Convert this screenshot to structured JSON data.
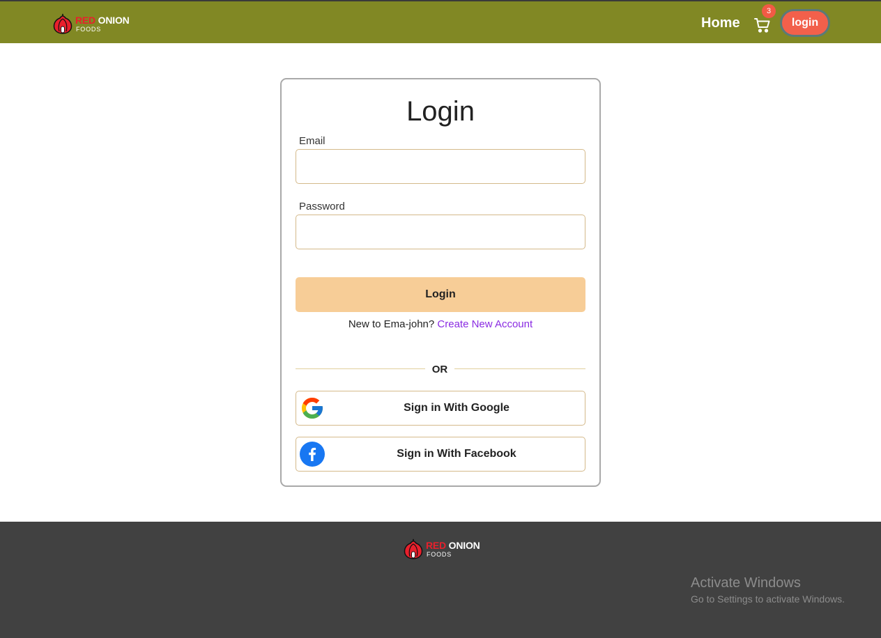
{
  "brand": {
    "name_red": "RED",
    "name_white": "ONION",
    "tagline": "FOODS"
  },
  "nav": {
    "home_label": "Home",
    "cart_count": "3",
    "login_label": "login"
  },
  "form": {
    "title": "Login",
    "email_label": "Email",
    "email_value": "",
    "password_label": "Password",
    "password_value": "",
    "submit_label": "Login",
    "new_user_text": "New to Ema-john?",
    "create_account_link": "Create New Account",
    "divider_text": "OR",
    "google_label": "Sign in With Google",
    "facebook_label": "Sign in With Facebook"
  },
  "icons": {
    "cart": "cart-icon",
    "google": "google-icon",
    "facebook": "facebook-icon",
    "logo": "onion-logo"
  },
  "colors": {
    "navbar": "#818824",
    "login_pill": "#f2604b",
    "login_button": "#f7cd97",
    "link": "#8a2be2",
    "footer": "#414141"
  },
  "system_overlay": {
    "title": "Activate Windows",
    "subtitle": "Go to Settings to activate Windows."
  }
}
